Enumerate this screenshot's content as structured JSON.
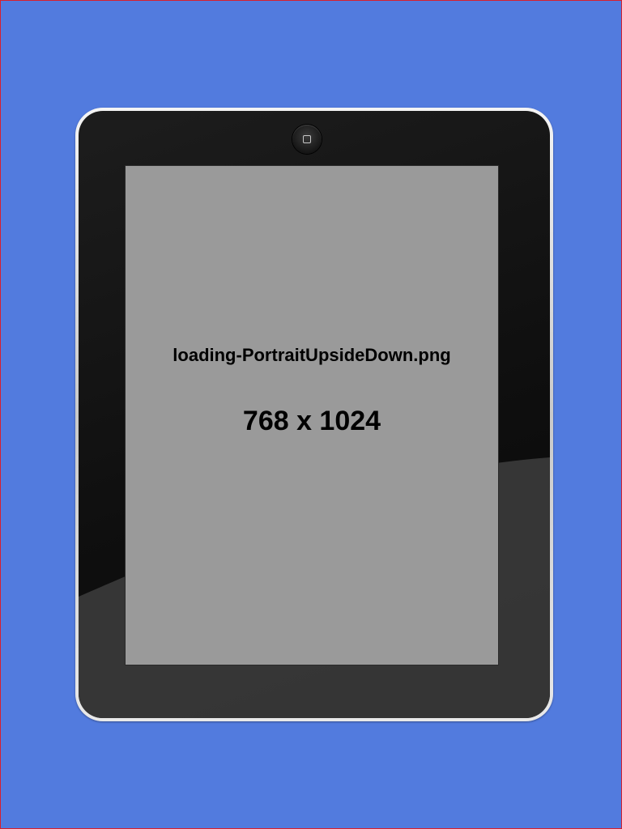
{
  "background_color": "#527bde",
  "device": {
    "home_button_icon": "home-button-square-icon",
    "bezel_color": "#111111",
    "screen_color": "#9a9a9a"
  },
  "screen": {
    "filename": "loading-PortraitUpsideDown.png",
    "dimensions": "768 x 1024"
  }
}
